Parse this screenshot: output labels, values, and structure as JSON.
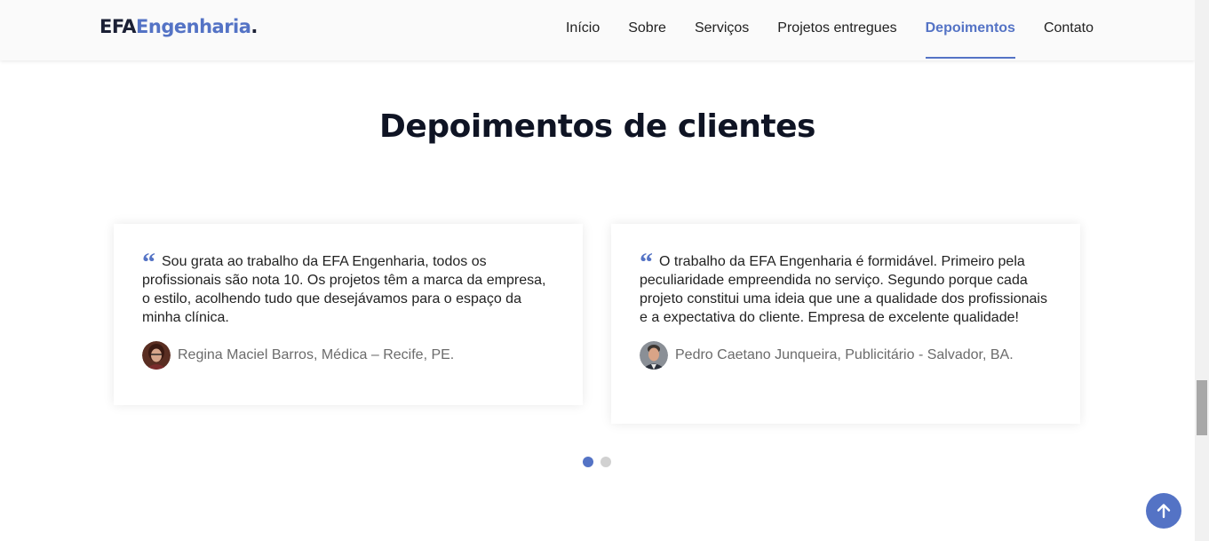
{
  "header": {
    "logo": {
      "part1": "EFA",
      "part2": "Engenharia",
      "part3": "."
    },
    "nav": [
      {
        "label": "Início",
        "active": false
      },
      {
        "label": "Sobre",
        "active": false
      },
      {
        "label": "Serviços",
        "active": false
      },
      {
        "label": "Projetos entregues",
        "active": false
      },
      {
        "label": "Depoimentos",
        "active": true
      },
      {
        "label": "Contato",
        "active": false
      }
    ]
  },
  "section": {
    "title": "Depoimentos de clientes",
    "testimonials": [
      {
        "quote_icon": "quote-icon",
        "text": "Sou grata ao trabalho da EFA Engenharia, todos os profissionais são nota 10. Os projetos têm a marca da empresa, o estilo, acolhendo tudo que desejávamos para o espaço da minha clínica.",
        "author": "Regina Maciel Barros, Médica – Recife, PE."
      },
      {
        "quote_icon": "quote-icon",
        "text": "O trabalho da EFA Engenharia é formidável. Primeiro pela peculiaridade empreendida no serviço. Segundo porque cada projeto constitui uma ideia que une a qualidade dos profissionais e a expectativa do cliente. Empresa de excelente qualidade!",
        "author": "Pedro Caetano Junqueira, Publicitário - Salvador, BA."
      }
    ],
    "pagination": {
      "pages": 2,
      "active_page": 1
    }
  },
  "colors": {
    "accent": "#5473c5",
    "dark": "#0f1424",
    "muted": "#6b6b6b",
    "dot_inactive": "#d1d1d1"
  },
  "scroll_top": {
    "icon": "arrow-up-icon"
  }
}
